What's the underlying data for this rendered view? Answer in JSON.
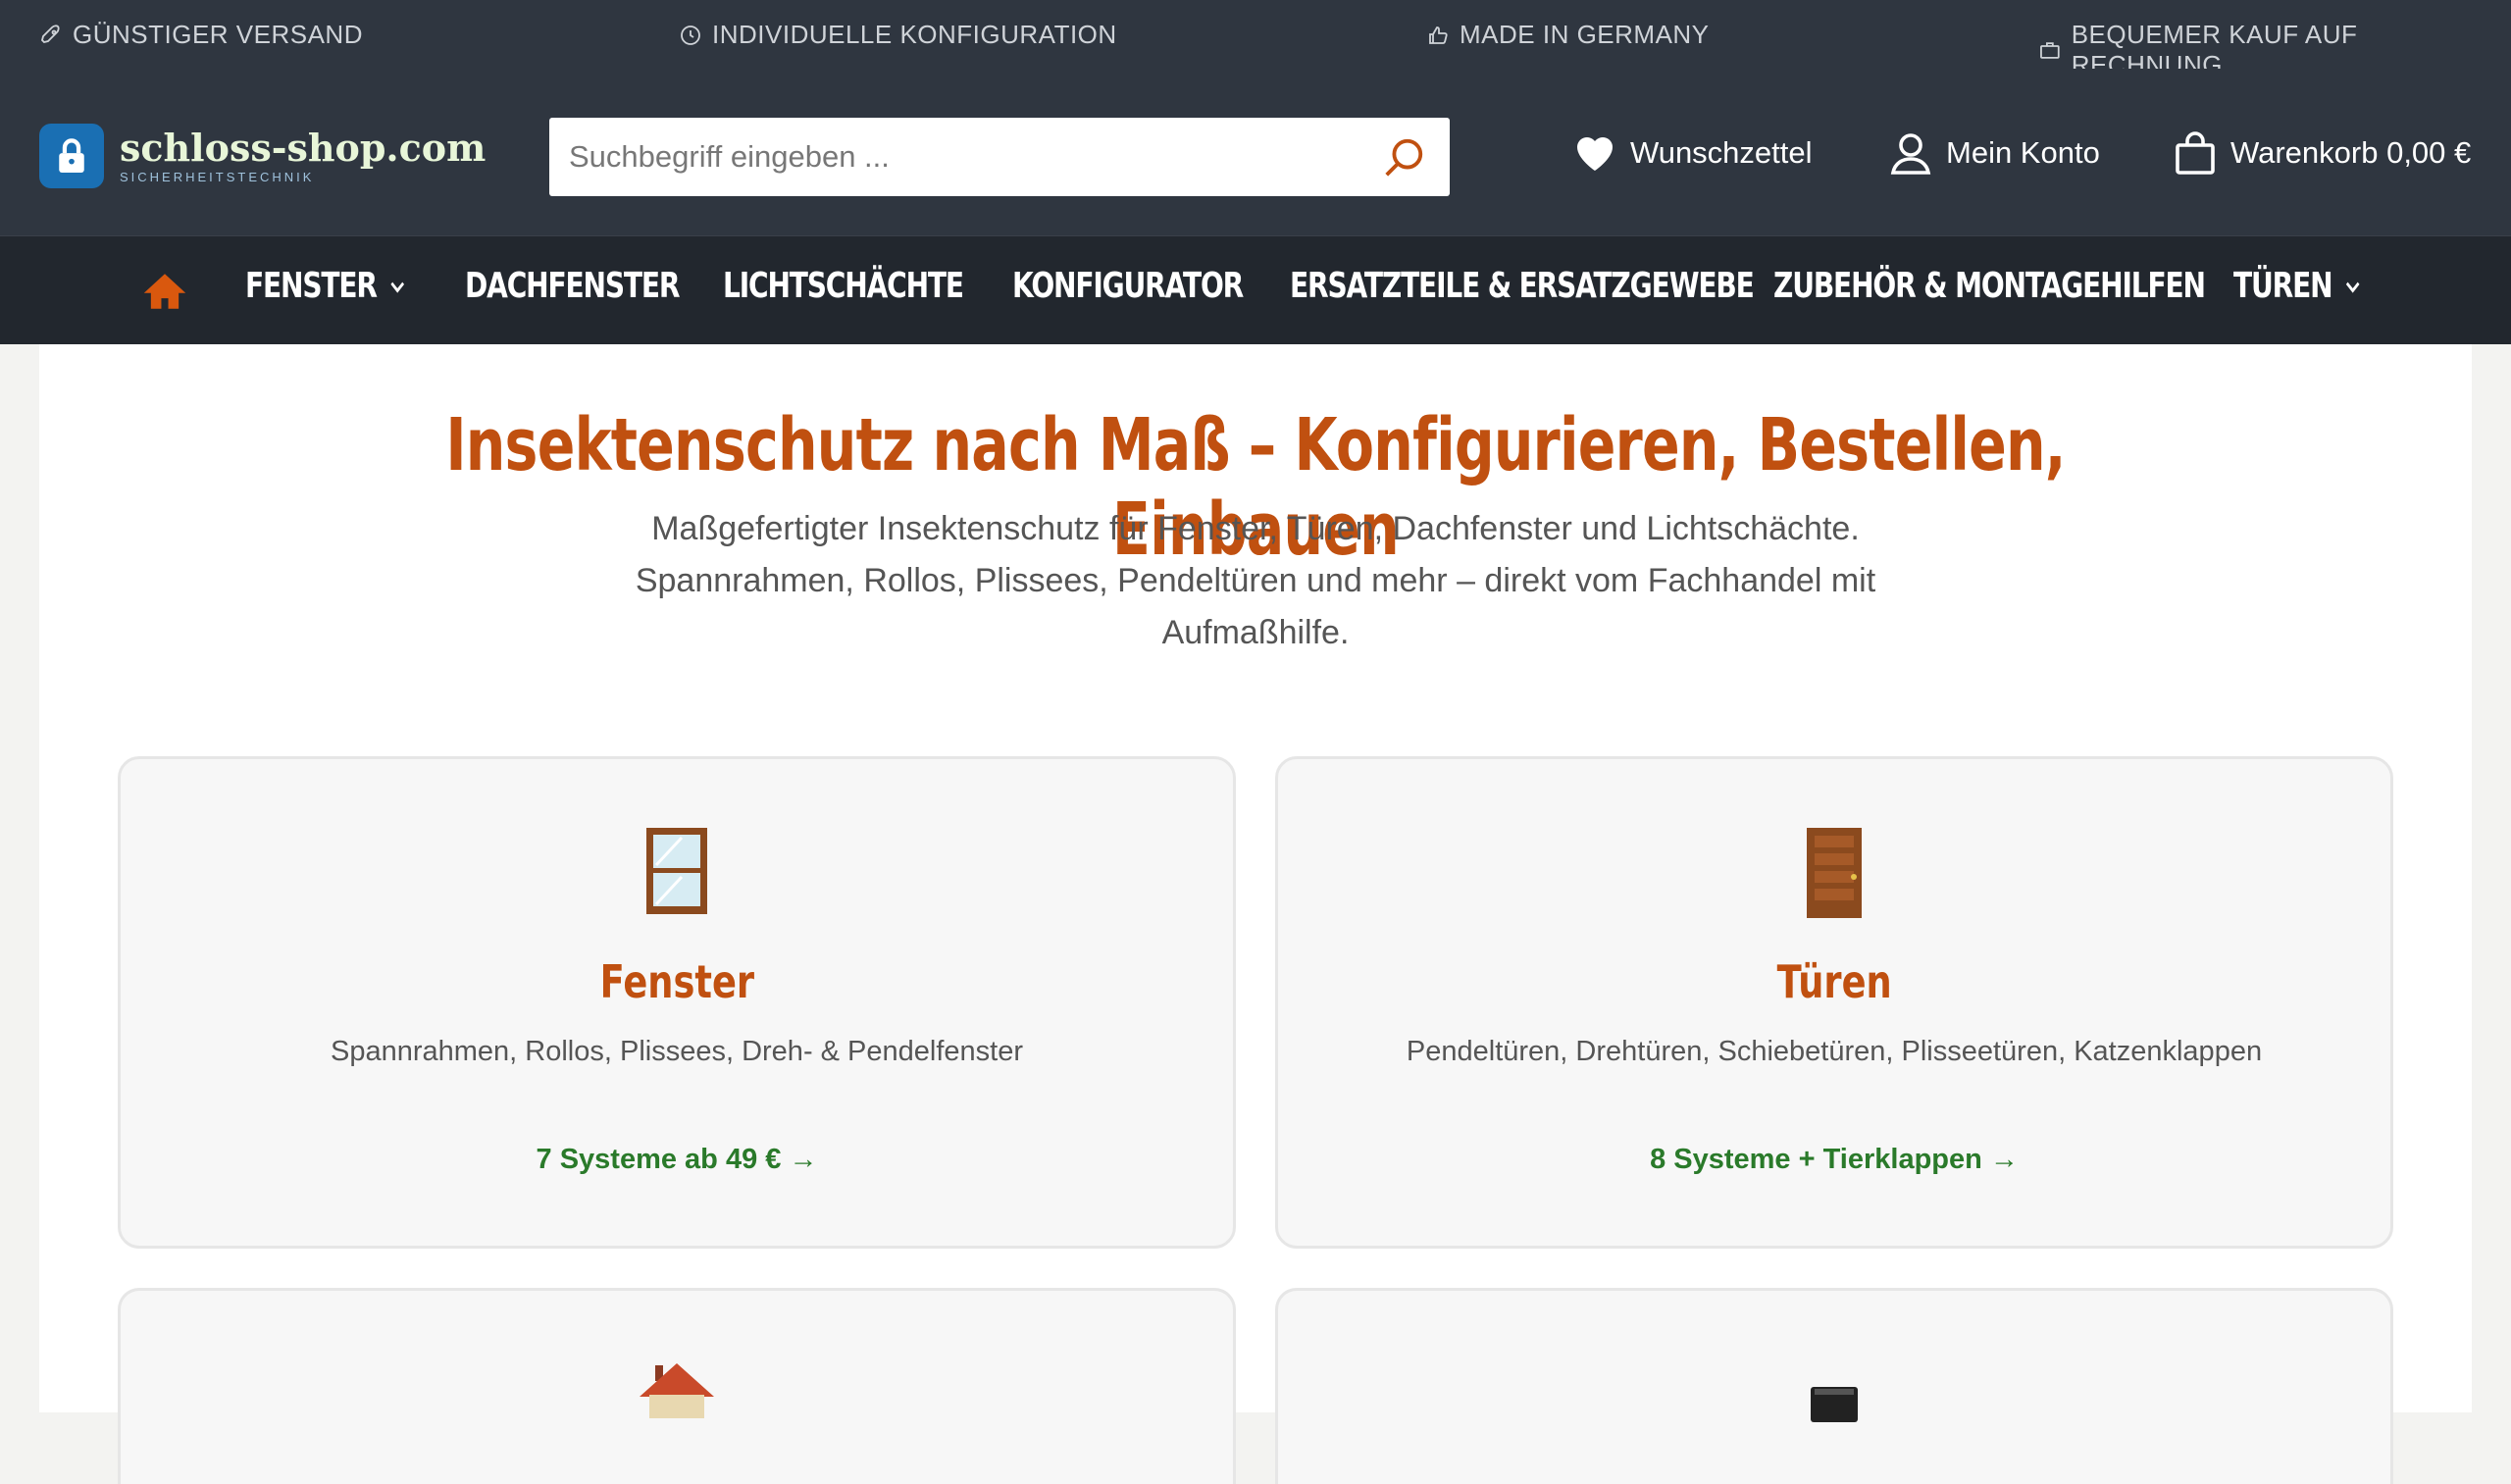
{
  "topbar": {
    "usps": [
      {
        "label": "GÜNSTIGER VERSAND",
        "icon": "rocket-icon"
      },
      {
        "label": "INDIVIDUELLE KONFIGURATION",
        "icon": "clock-icon"
      },
      {
        "label": "MADE IN GERMANY",
        "icon": "thumbs-up-icon"
      },
      {
        "label": "BEQUEMER KAUF AUF RECHNUNG",
        "icon": "briefcase-icon"
      }
    ]
  },
  "header": {
    "logo_name": "schloss-shop.com",
    "logo_sub": "SICHERHEITSTECHNIK",
    "search_placeholder": "Suchbegriff eingeben ...",
    "wishlist": "Wunschzettel",
    "account": "Mein Konto",
    "cart": "Warenkorb 0,00 €"
  },
  "nav": {
    "items": [
      "FENSTER",
      "DACHFENSTER",
      "LICHTSCHÄCHTE",
      "KONFIGURATOR",
      "ERSATZTEILE & ERSATZGEWEBE",
      "ZUBEHÖR & MONTAGEHILFEN",
      "TÜREN"
    ]
  },
  "hero": {
    "title": "Insektenschutz nach Maß – Konfigurieren, Bestellen, Einbauen",
    "subtitle_line1": "Maßgefertigter Insektenschutz für Fenster, Türen, Dachfenster und Lichtschächte.",
    "subtitle_line2": "Spannrahmen, Rollos, Plissees, Pendeltüren und mehr – direkt vom Fachhandel mit",
    "subtitle_line3": "Aufmaßhilfe."
  },
  "cards": [
    {
      "title": "Fenster",
      "desc": "Spannrahmen, Rollos, Plissees, Dreh- & Pendelfenster",
      "link": "7 Systeme ab 49 € →",
      "icon": "window-icon"
    },
    {
      "title": "Türen",
      "desc": "Pendeltüren, Drehtüren, Schiebetüren, Plisseetüren, Katzenklappen",
      "link": "8 Systeme + Tierklappen →",
      "icon": "door-icon"
    },
    {
      "icon": "house-icon"
    },
    {
      "icon": "light-well-icon"
    }
  ],
  "colors": {
    "header_bg": "#2f3640",
    "nav_bg": "#22272e",
    "accent": "#c05010",
    "link_green": "#2a7a2a",
    "logo_blue": "#1a6fb3"
  }
}
